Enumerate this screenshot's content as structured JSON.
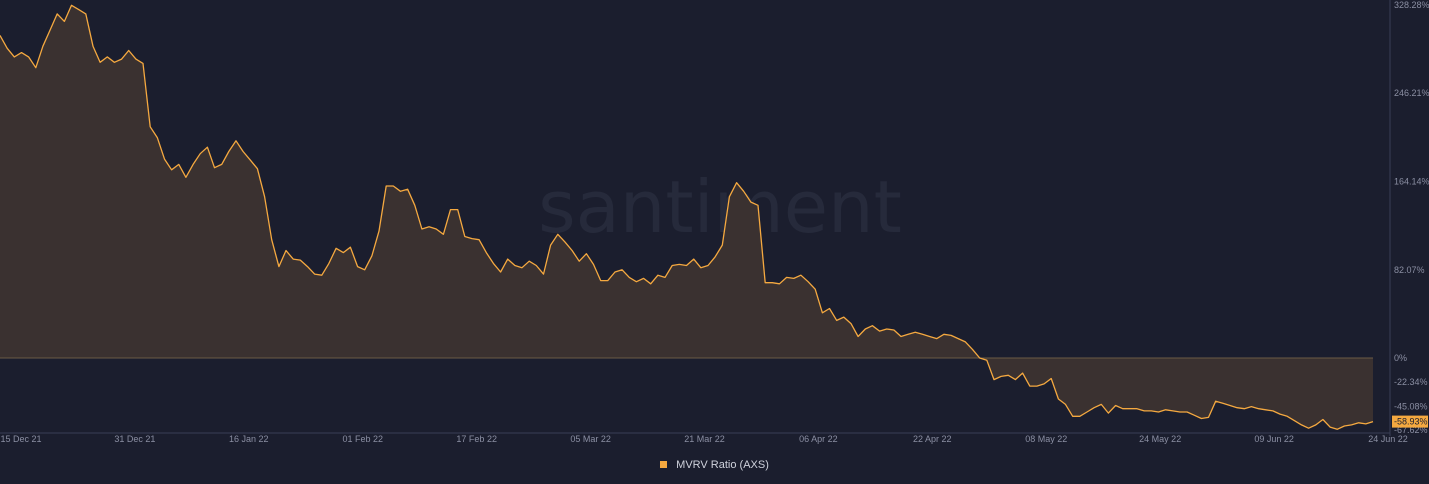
{
  "watermark": "santiment",
  "colors": {
    "background": "#1b1e2e",
    "line": "#f5a940",
    "fill": "#3a3130",
    "axis": "#3a3f55",
    "tick_text": "#8b8fa3",
    "current_badge": "#f5a940"
  },
  "legend": {
    "label": "MVRV Ratio (AXS)",
    "swatch_color": "#f5a940"
  },
  "chart_data": {
    "type": "area",
    "title": "",
    "xlabel": "",
    "ylabel": "",
    "ylim": [
      -67.62,
      328.28
    ],
    "y_ticks": [
      "328.28%",
      "246.21%",
      "164.14%",
      "82.07%",
      "0%",
      "-22.34%",
      "-45.08%",
      "-67.62%"
    ],
    "y_tick_values": [
      328.28,
      246.21,
      164.14,
      82.07,
      0,
      -22.34,
      -45.08,
      -67.62
    ],
    "x_ticks": [
      "15 Dec 21",
      "31 Dec 21",
      "16 Jan 22",
      "01 Feb 22",
      "17 Feb 22",
      "05 Mar 22",
      "21 Mar 22",
      "06 Apr 22",
      "22 Apr 22",
      "08 May 22",
      "24 May 22",
      "09 Jun 22",
      "24 Jun 22"
    ],
    "x_start": "2021-12-15",
    "current_value_label": "-58.93%",
    "series": [
      {
        "name": "MVRV Ratio (AXS)",
        "values": [
          300,
          288,
          280,
          284,
          280,
          270,
          290,
          305,
          320,
          313,
          328,
          324,
          320,
          290,
          275,
          280,
          275,
          278,
          286,
          278,
          274,
          215,
          205,
          185,
          175,
          180,
          168,
          180,
          190,
          196,
          177,
          180,
          192,
          202,
          192,
          184,
          176,
          150,
          110,
          85,
          100,
          92,
          91,
          85,
          78,
          77,
          88,
          102,
          98,
          103,
          85,
          82,
          95,
          118,
          160,
          160,
          155,
          157,
          142,
          120,
          122,
          120,
          115,
          138,
          138,
          113,
          111,
          110,
          98,
          88,
          80,
          92,
          86,
          84,
          90,
          86,
          78,
          105,
          115,
          108,
          100,
          90,
          97,
          87,
          72,
          72,
          80,
          82,
          75,
          71,
          74,
          69,
          77,
          75,
          86,
          87,
          86,
          92,
          84,
          86,
          94,
          105,
          150,
          163,
          155,
          145,
          142,
          70,
          70,
          69,
          75,
          74,
          77,
          71,
          64,
          42,
          46,
          35,
          38,
          32,
          20,
          27,
          30,
          25,
          27,
          26,
          20,
          22,
          24,
          22,
          20,
          18,
          22,
          21,
          18,
          15,
          8,
          0,
          -2,
          -20,
          -17,
          -16,
          -20,
          -14,
          -26,
          -26,
          -24,
          -19,
          -38,
          -43,
          -54,
          -54,
          -50,
          -46,
          -43,
          -51,
          -44,
          -47,
          -47,
          -47,
          -49,
          -49,
          -50,
          -48,
          -49,
          -50,
          -50,
          -53,
          -56,
          -55,
          -40,
          -42,
          -44,
          -46,
          -47,
          -45,
          -47,
          -48,
          -49,
          -52,
          -54,
          -58,
          -62,
          -65,
          -62,
          -57,
          -64,
          -66,
          -63,
          -62,
          -60,
          -61,
          -58.93
        ]
      }
    ]
  }
}
